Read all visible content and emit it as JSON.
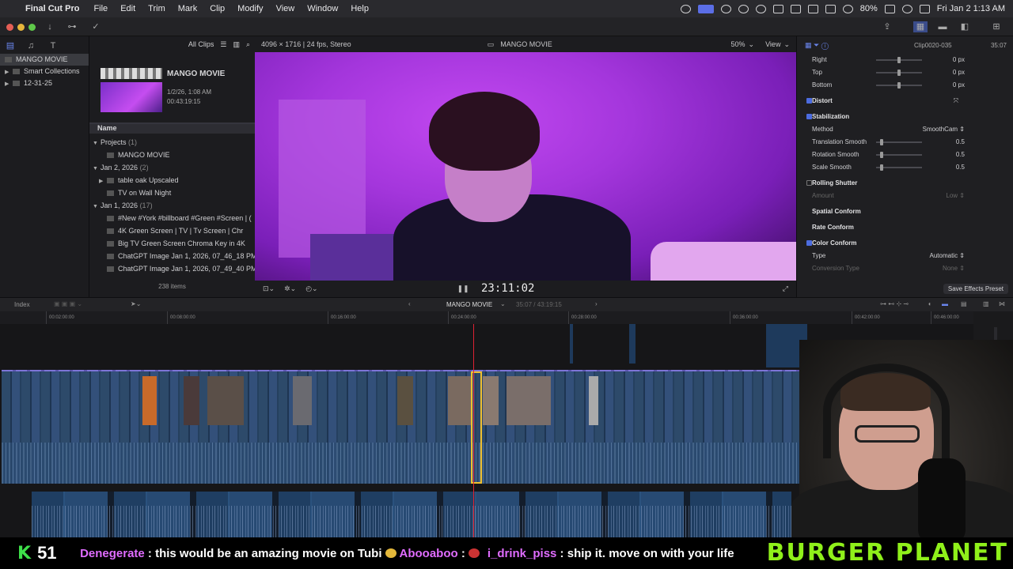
{
  "menubar": {
    "app": "Final Cut Pro",
    "items": [
      "File",
      "Edit",
      "Trim",
      "Mark",
      "Clip",
      "Modify",
      "View",
      "Window",
      "Help"
    ],
    "battery": "80%",
    "clock": "Fri Jan 2 1:13 AM"
  },
  "sidebar": {
    "library": "MANGO MOVIE",
    "items": [
      "Smart Collections",
      "12-31-25"
    ]
  },
  "browser": {
    "filter": "All Clips",
    "project_title": "MANGO MOVIE",
    "project_date": "1/2/26, 1:08 AM",
    "project_duration": "00:43:19:15",
    "column_name": "Name",
    "rows": [
      {
        "label": "Projects",
        "count": "(1)"
      },
      {
        "label": "MANGO MOVIE",
        "count": ""
      },
      {
        "label": "Jan 2, 2026",
        "count": "(2)"
      },
      {
        "label": "table oak Upscaled",
        "count": ""
      },
      {
        "label": "TV on Wall Night",
        "count": ""
      },
      {
        "label": "Jan 1, 2026",
        "count": "(17)"
      },
      {
        "label": "#New #York #billboard #Green #Screen | (",
        "count": ""
      },
      {
        "label": "4K Green Screen  |  TV  |  Tv Screen  |  Chr",
        "count": ""
      },
      {
        "label": "Big TV Green Screen Chroma Key in 4K",
        "count": ""
      },
      {
        "label": "ChatGPT Image Jan 1, 2026, 07_46_18 PM",
        "count": ""
      },
      {
        "label": "ChatGPT Image Jan 1, 2026, 07_49_40 PM",
        "count": ""
      }
    ],
    "item_count": "238 items"
  },
  "viewer": {
    "format": "4096 × 1716 | 24 fps, Stereo",
    "title": "MANGO MOVIE",
    "zoom": "50%",
    "view": "View",
    "timecode": "23:11:02"
  },
  "inspector": {
    "clip_name": "Clip0020-035",
    "clip_duration": "35:07",
    "rows": [
      {
        "label": "Right",
        "value": "0 px",
        "type": "slider",
        "level": 0.5
      },
      {
        "label": "Top",
        "value": "0 px",
        "type": "slider",
        "level": 0.5
      },
      {
        "label": "Bottom",
        "value": "0 px",
        "type": "slider",
        "level": 0.5
      },
      {
        "label": "Distort",
        "value": "",
        "type": "section",
        "checked": true
      },
      {
        "label": "Stabilization",
        "value": "",
        "type": "section",
        "checked": true
      },
      {
        "label": "Method",
        "value": "SmoothCam ⇕",
        "type": "popup"
      },
      {
        "label": "Translation Smooth",
        "value": "0.5",
        "type": "slider",
        "level": 0.1
      },
      {
        "label": "Rotation Smooth",
        "value": "0.5",
        "type": "slider",
        "level": 0.1
      },
      {
        "label": "Scale Smooth",
        "value": "0.5",
        "type": "slider",
        "level": 0.1
      },
      {
        "label": "Rolling Shutter",
        "value": "",
        "type": "section",
        "checked": false
      },
      {
        "label": "Amount",
        "value": "Low ⇕",
        "type": "popup-dim"
      },
      {
        "label": "Spatial Conform",
        "value": "",
        "type": "section-plain"
      },
      {
        "label": "Rate Conform",
        "value": "",
        "type": "section-plain"
      },
      {
        "label": "Color Conform",
        "value": "",
        "type": "section",
        "checked": true
      },
      {
        "label": "Type",
        "value": "Automatic ⇕",
        "type": "popup"
      },
      {
        "label": "Conversion Type",
        "value": "None ⇕",
        "type": "popup-dim"
      }
    ],
    "save_preset": "Save Effects Preset"
  },
  "timeline": {
    "index": "Index",
    "project": "MANGO MOVIE",
    "position": "35:07 / 43:19:15",
    "ruler": [
      "00:02:00:00",
      "00:08:00:00",
      "00:16:00:00",
      "00:24:00:00",
      "00:28:00:00",
      "00:36:00:00",
      "00:42:00:00",
      "00:46:00:00"
    ]
  },
  "ticker": {
    "k": "K",
    "count": "51",
    "user1": "Denegerate",
    "msg1": " : this would be an amazing movie on Tubi",
    "user2": "Abooaboo",
    "msg2": " : ",
    "user3": "i_drink_piss",
    "msg3": " : ship it. move on with your life",
    "brand": "BURGER PLANET"
  },
  "colors": {
    "accent": "#4c6ce0",
    "clip": "#2d4a6a",
    "clip_header": "#7d74d6",
    "playhead": "#dd2233",
    "selection": "#f0c030",
    "ticker_green": "#8ff01a"
  }
}
